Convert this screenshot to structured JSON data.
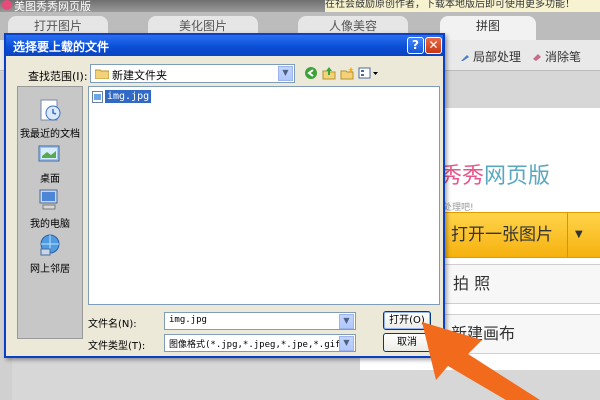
{
  "app": {
    "title": "美图秀秀网页版",
    "notice": "在社会鼓励原创作者，下载本地版后即可使用更多功能！"
  },
  "tabs": [
    "打开图片",
    "美化图片",
    "人像美容",
    "拼图"
  ],
  "toolbar": {
    "local_process": "局部处理",
    "eraser": "消除笔"
  },
  "welcome": {
    "brand_hot": "秀秀",
    "brand_rest": "网页版",
    "subtext": "处理吧!",
    "open_image": "打开一张图片",
    "take_photo": "拍  照",
    "new_canvas": "新建画布"
  },
  "dialog": {
    "title": "选择要上载的文件",
    "help": "?",
    "close": "✕",
    "look_in_label": "查找范围(I):",
    "look_in_value": "新建文件夹",
    "places": [
      "我最近的文档",
      "桌面",
      "我的电脑",
      "网上邻居"
    ],
    "files": [
      "img.jpg"
    ],
    "filename_label": "文件名(N):",
    "filename_value": "img.jpg",
    "filetype_label": "文件类型(T):",
    "filetype_value": "图像格式(*.jpg,*.jpeg,*.jpe,*.gif,*.p",
    "open_button": "打开(O)",
    "cancel_button": "取消"
  },
  "colors": {
    "accent_arrow": "#f26a1b",
    "open_button_fill": "#f8c01f",
    "dialog_title_blue": "#0b4fd6"
  }
}
